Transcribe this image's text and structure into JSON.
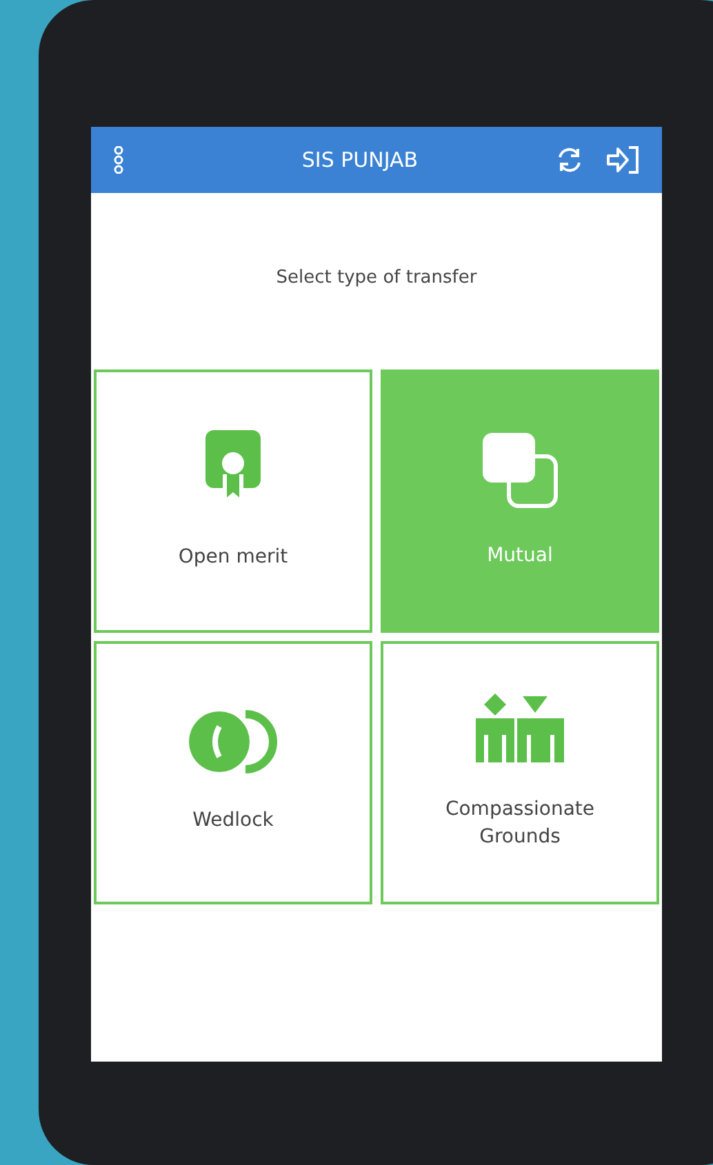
{
  "header": {
    "title": "SIS PUNJAB"
  },
  "prompt": "Select type of transfer",
  "options": [
    {
      "label": "Open merit",
      "kind": "award",
      "selected": false
    },
    {
      "label": "Mutual",
      "kind": "swap",
      "selected": true
    },
    {
      "label": "Wedlock",
      "kind": "rings",
      "selected": false
    },
    {
      "label": "Compassionate Grounds",
      "kind": "people",
      "selected": false
    }
  ]
}
